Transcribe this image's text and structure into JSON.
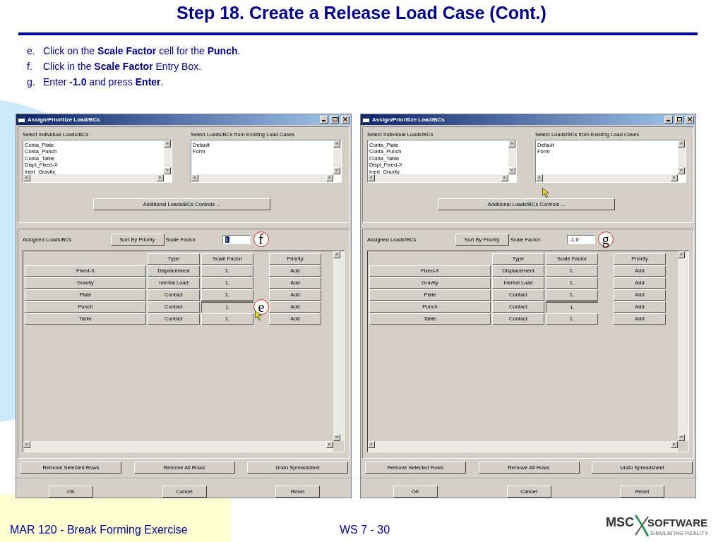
{
  "slide_title": "Step 18. Create a Release Load Case (Cont.)",
  "steps": [
    {
      "marker": "e.",
      "text": "Click on the **Scale Factor** cell for the **Punch**."
    },
    {
      "marker": "f.",
      "text": "Click in the **Scale Factor** Entry Box."
    },
    {
      "marker": "g.",
      "text": "Enter **-1.0** and press **Enter**."
    }
  ],
  "windows": [
    {
      "title": "Assign/Prioritize Load/BCs",
      "individual_label": "Select Individual Loads/BCs",
      "individual_items": [
        "Conta_Plate",
        "Conta_Punch",
        "Conta_Table",
        "Displ_Fixed-X",
        "Inert_Gravity"
      ],
      "existing_label": "Select Loads/BCs from Existing Load Cases",
      "existing_items": [
        "Default",
        "Form"
      ],
      "additional_button": {
        "label": "Additional Loads/BCs Controls ...",
        "cursor": false
      },
      "assigned_label": "Assigned Loads/BCs",
      "sort_button": "Sort By Priority",
      "scale_factor_label": "Scale Factor:",
      "scale_factor": {
        "value": "1.",
        "selected": true,
        "callout": "f"
      },
      "columns": [
        "Type",
        "Scale Factor",
        "Priority"
      ],
      "rows": [
        {
          "name": "Fixed-X",
          "type": "Displacement",
          "scale_factor": "1.",
          "scale_selected": false,
          "priority": "Add"
        },
        {
          "name": "Gravity",
          "type": "Inertial Load",
          "scale_factor": "1.",
          "scale_selected": false,
          "priority": "Add"
        },
        {
          "name": "Plate",
          "type": "Contact",
          "scale_factor": "1.",
          "scale_selected": false,
          "priority": "Add"
        },
        {
          "name": "Punch",
          "type": "Contact",
          "scale_factor": "1.",
          "scale_selected": true,
          "priority": "Add"
        },
        {
          "name": "Table",
          "type": "Contact",
          "scale_factor": "1.",
          "scale_selected": false,
          "priority": "Add"
        }
      ],
      "action_buttons": [
        "Remove Selected Rows",
        "Remove All Rows",
        "Undo Spreadsheet"
      ],
      "dialog_buttons": [
        "OK",
        "Cancel",
        "Reset"
      ],
      "table_callout": {
        "label": "e",
        "cursor": true
      }
    },
    {
      "title": "Assign/Prioritize Load/BCs",
      "individual_label": "Select Individual Loads/BCs",
      "individual_items": [
        "Conta_Plate",
        "Conta_Punch",
        "Conta_Table",
        "Displ_Fixed-X",
        "Inert_Gravity"
      ],
      "existing_label": "Select Loads/BCs from Existing Load Cases",
      "existing_items": [
        "Default",
        "Form"
      ],
      "additional_button": {
        "label": "Additional Loads/BCs Controls ...",
        "cursor": true
      },
      "assigned_label": "Assigned Loads/BCs",
      "sort_button": "Sort By Priority",
      "scale_factor_label": "Scale Factor:",
      "scale_factor": {
        "value": "-1.0",
        "selected": false,
        "callout": "g"
      },
      "columns": [
        "Type",
        "Scale Factor",
        "Priority"
      ],
      "rows": [
        {
          "name": "Fixed-X",
          "type": "Displacement",
          "scale_factor": "1.",
          "scale_selected": false,
          "priority": "Add"
        },
        {
          "name": "Gravity",
          "type": "Inertial Load",
          "scale_factor": "1.",
          "scale_selected": false,
          "priority": "Add"
        },
        {
          "name": "Plate",
          "type": "Contact",
          "scale_factor": "1.",
          "scale_selected": false,
          "priority": "Add"
        },
        {
          "name": "Punch",
          "type": "Contact",
          "scale_factor": "1.",
          "scale_selected": true,
          "priority": "Add"
        },
        {
          "name": "Table",
          "type": "Contact",
          "scale_factor": "1.",
          "scale_selected": false,
          "priority": "Add"
        }
      ],
      "action_buttons": [
        "Remove Selected Rows",
        "Remove All Rows",
        "Undo Spreadsheet"
      ],
      "dialog_buttons": [
        "OK",
        "Cancel",
        "Reset"
      ],
      "table_callout": {
        "cursor": false
      }
    }
  ],
  "footer": {
    "course": "MAR 120 - Break Forming Exercise",
    "page": "WS 7 - 30",
    "logo_left": "MSC",
    "logo_right": "SOFTWARE",
    "logo_tagline": "SIMULATING REALITY"
  }
}
